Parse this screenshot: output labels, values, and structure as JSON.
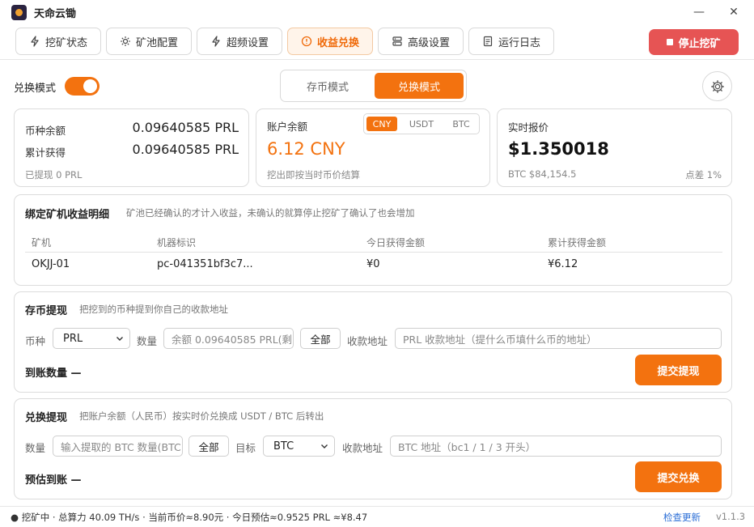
{
  "window": {
    "title": "天命云锄",
    "min": "—",
    "close": "✕"
  },
  "nav": {
    "tabs": [
      {
        "label": "挖矿状态",
        "icon": "bolt-icon"
      },
      {
        "label": "矿池配置",
        "icon": "sun-icon"
      },
      {
        "label": "超频设置",
        "icon": "bolt-icon"
      },
      {
        "label": "收益兑换",
        "icon": "coin-icon"
      },
      {
        "label": "高级设置",
        "icon": "server-icon"
      },
      {
        "label": "运行日志",
        "icon": "document-icon"
      }
    ],
    "stop_label": "停止挖矿"
  },
  "colors": {
    "accent": "#f3720f",
    "danger": "#e65454"
  },
  "controls": {
    "toggle_label": "兑换模式",
    "mode_save": "存币模式",
    "mode_exchange": "兑换模式"
  },
  "coin_card": {
    "balance_label": "币种余额",
    "balance_value": "0.09640585 PRL",
    "total_label": "累计获得",
    "total_value": "0.09640585 PRL",
    "withdrawn": "已提现 0 PRL"
  },
  "account_card": {
    "label": "账户余额",
    "value": "6.12 CNY",
    "note": "挖出即按当时币价结算",
    "currencies": [
      "CNY",
      "USDT",
      "BTC"
    ]
  },
  "price_card": {
    "label": "实时报价",
    "value": "$1.350018",
    "btc": "BTC $84,154.5",
    "spread": "点差 1%"
  },
  "detail": {
    "title": "绑定矿机收益明细",
    "desc": "矿池已经确认的才计入收益，未确认的就算停止挖矿了确认了也会增加",
    "headers": [
      "矿机",
      "机器标识",
      "今日获得金额",
      "累计获得金额"
    ],
    "row": [
      "OKJJ-01",
      "pc-041351bf3c7...",
      "¥0",
      "¥6.12"
    ]
  },
  "withdraw_coin": {
    "title": "存币提现",
    "desc": "把挖到的币种提到你自己的收款地址",
    "coin_label": "币种",
    "coin_value": "PRL",
    "amount_label": "数量",
    "amount_placeholder": "余额 0.09640585 PRL(剩)",
    "all_label": "全部",
    "addr_label": "收款地址",
    "addr_placeholder": "PRL 收款地址（提什么币填什么币的地址）",
    "arrive_label": "到账数量 —",
    "submit": "提交提现"
  },
  "withdraw_exchange": {
    "title": "兑换提现",
    "desc": "把账户余额（人民币）按实时价兑换成 USDT / BTC 后转出",
    "amount_label": "数量",
    "amount_placeholder": "输入提取的 BTC 数量(BTC",
    "all_label": "全部",
    "target_label": "目标",
    "target_value": "BTC",
    "addr_label": "收款地址",
    "addr_placeholder": "BTC 地址（bc1 / 1 / 3 开头）",
    "estimate_label": "预估到账 —",
    "submit": "提交兑换"
  },
  "status": {
    "text": "● 挖矿中 · 总算力 40.09 TH/s · 当前币价≈8.90元 · 今日预估≈0.9525 PRL ≈¥8.47",
    "check_update": "检查更新",
    "version": "v1.1.3"
  }
}
